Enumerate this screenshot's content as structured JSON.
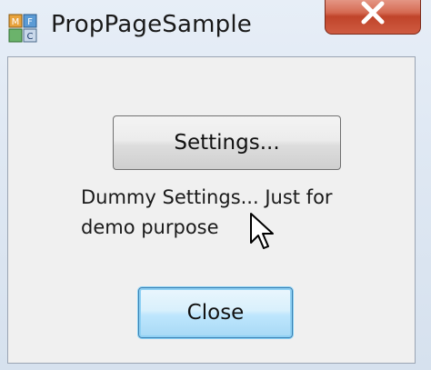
{
  "window": {
    "title": "PropPageSample"
  },
  "content": {
    "settings_button_label": "Settings...",
    "description": "Dummy Settings... Just for demo purpose",
    "close_button_label": "Close"
  },
  "colors": {
    "close_button_accent": "#c0442a",
    "focused_button_border": "#3c7fb1"
  }
}
